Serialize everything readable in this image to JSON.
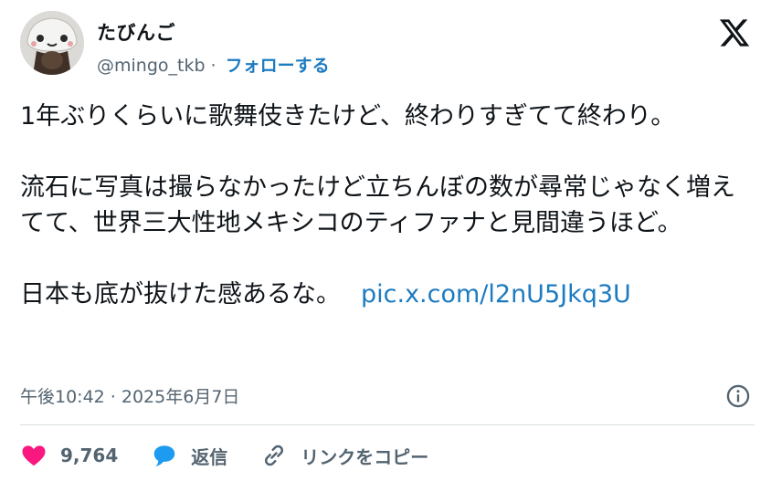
{
  "author": {
    "name": "たびんご",
    "handle": "@mingo_tkb",
    "separator": "·",
    "follow_label": "フォローする"
  },
  "tweet": {
    "para1": "1年ぶりくらいに歌舞伎きたけど、終わりすぎてて終わり。",
    "para2": "流石に写真は撮らなかったけど立ちんぼの数が尋常じゃなく増えてて、世界三大性地メキシコのティファナと見間違うほど。",
    "para3": "日本も底が抜けた感あるな。",
    "link": "pic.x.com/l2nU5Jkq3U",
    "timestamp": "午後10:42 · 2025年6月7日"
  },
  "actions": {
    "like_count": "9,764",
    "reply_label": "返信",
    "copy_link_label": "リンクをコピー"
  },
  "colors": {
    "like": "#f91880",
    "reply": "#1d9bf0",
    "link": "#1d7bc1",
    "muted": "#536471"
  },
  "icons": {
    "brand": "x-logo-icon",
    "info": "info-icon",
    "like": "heart-icon",
    "reply": "speech-bubble-icon",
    "copy": "link-icon"
  }
}
